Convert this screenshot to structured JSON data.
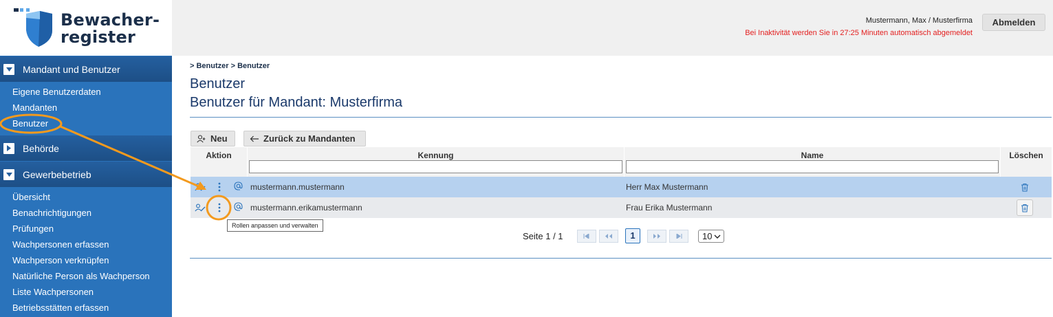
{
  "app": {
    "logo_line1": "Bewacher-",
    "logo_line2": "register"
  },
  "header": {
    "user_label": "Mustermann, Max / Musterfirma",
    "inactivity_notice": "Bei Inaktivität werden Sie in 27:25 Minuten automatisch abgemeldet",
    "logout_label": "Abmelden"
  },
  "sidebar": {
    "sections": [
      {
        "label": "Mandant und Benutzer",
        "expanded": true,
        "items": [
          "Eigene Benutzerdaten",
          "Mandanten",
          "Benutzer"
        ]
      },
      {
        "label": "Behörde",
        "expanded": false,
        "items": []
      },
      {
        "label": "Gewerbebetrieb",
        "expanded": true,
        "items": [
          "Übersicht",
          "Benachrichtigungen",
          "Prüfungen",
          "Wachpersonen erfassen",
          "Wachperson verknüpfen",
          "Natürliche Person als Wachperson",
          "Liste Wachpersonen",
          "Betriebsstätten erfassen"
        ]
      }
    ]
  },
  "main": {
    "breadcrumb": "> Benutzer > Benutzer",
    "title": "Benutzer",
    "subtitle": "Benutzer für Mandant: Musterfirma",
    "new_button": "Neu",
    "back_button": "Zurück zu Mandanten"
  },
  "table": {
    "columns": {
      "action": "Aktion",
      "kennung": "Kennung",
      "name": "Name",
      "delete": "Löschen"
    },
    "filters": {
      "kennung": "",
      "name": ""
    },
    "rows": [
      {
        "kennung": "mustermann.mustermann",
        "name": "Herr Max Mustermann",
        "selected": true
      },
      {
        "kennung": "mustermann.erikamustermann",
        "name": "Frau Erika Mustermann",
        "selected": false
      }
    ]
  },
  "tooltip": {
    "text": "Rollen anpassen und verwalten"
  },
  "pager": {
    "label": "Seite 1 / 1",
    "current_page": "1",
    "page_size": "10"
  },
  "colors": {
    "sidebar": "#2a73bb",
    "annotation": "#f39a1e",
    "selected_row": "#b6d1ef",
    "warning": "#e31f1f"
  }
}
